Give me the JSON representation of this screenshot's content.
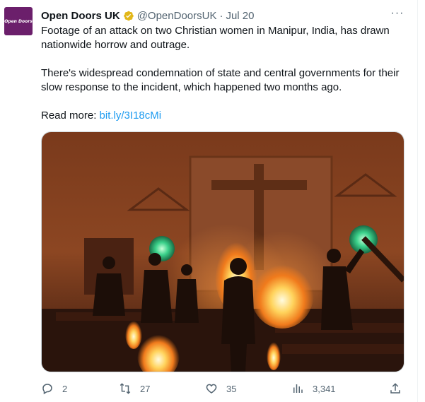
{
  "tweet": {
    "author_name": "Open Doors UK",
    "handle": "@OpenDoorsUK",
    "separator": "·",
    "date": "Jul 20",
    "avatar_text": "Open Doors",
    "more_label": "···",
    "paragraph1": "Footage of an attack on two Christian women in Manipur, India, has drawn nationwide horrow and outrage.",
    "paragraph2": "There's widespread condemnation of state and central governments for their slow response to the incident, which happened two months ago.",
    "read_more_label": "Read more:",
    "read_more_link": "bit.ly/3I18cMi"
  },
  "actions": {
    "replies": "2",
    "retweets": "27",
    "likes": "35",
    "views": "3,341"
  },
  "icons": {
    "verified": "verified-gold-badge",
    "reply": "reply-icon",
    "retweet": "retweet-icon",
    "like": "heart-icon",
    "views": "views-bar-chart-icon",
    "share": "share-icon"
  },
  "colors": {
    "accent": "#1d9bf0",
    "muted": "#536471",
    "verified_gold": "#e2b719",
    "avatar_bg": "#6b1f6b"
  }
}
